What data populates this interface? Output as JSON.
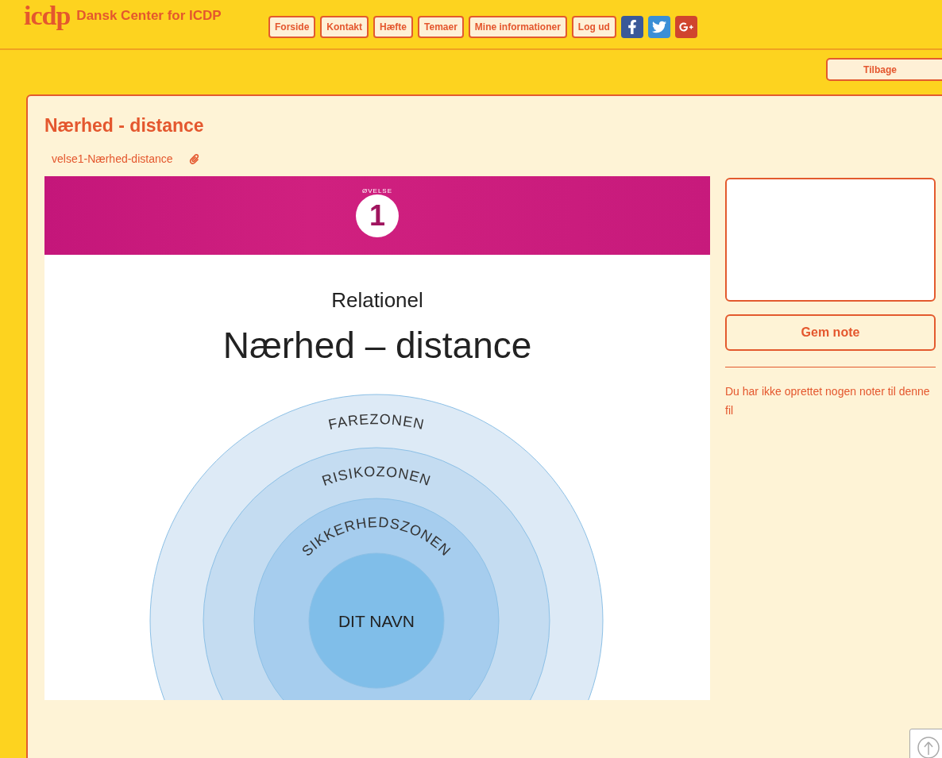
{
  "header": {
    "logo": "icdp",
    "brand": "Dansk Center for ICDP",
    "nav": [
      {
        "label": "Forside"
      },
      {
        "label": "Kontakt"
      },
      {
        "label": "Hæfte"
      },
      {
        "label": "Temaer"
      },
      {
        "label": "Mine informationer"
      },
      {
        "label": "Log ud"
      }
    ]
  },
  "back_button": "Tilbage",
  "page": {
    "title": "Nærhed - distance",
    "file_name": "velse1-Nærhed-distance",
    "document": {
      "badge_label": "ØVELSE",
      "badge_number": "1",
      "kicker": "Relationel",
      "heading": "Nærhed – distance",
      "zones": [
        "FAREZONEN",
        "RISIKOZONEN",
        "SIKKERHEDSZONEN"
      ],
      "center_label": "DIT NAVN"
    }
  },
  "notes": {
    "save_button": "Gem note",
    "empty_message": "Du har ikke oprettet nogen noter til denne fil"
  }
}
